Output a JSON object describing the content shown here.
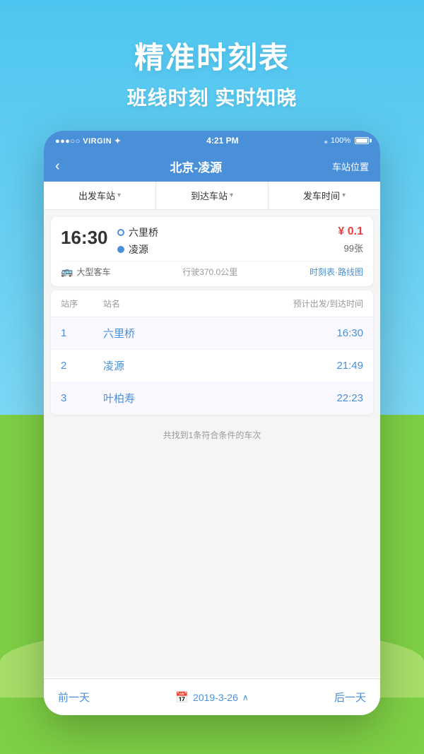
{
  "hero": {
    "title": "精准时刻表",
    "subtitle": "班线时刻 实时知晓"
  },
  "status_bar": {
    "left": "●●●○○ VIRGIN ✦",
    "center": "4:21 PM",
    "right": "100%"
  },
  "nav": {
    "back": "‹",
    "title": "北京-凌源",
    "action": "车站位置"
  },
  "filters": [
    {
      "label": "出发车站",
      "id": "departure"
    },
    {
      "label": "到达车站",
      "id": "arrival"
    },
    {
      "label": "发车时间",
      "id": "time"
    }
  ],
  "bus_card": {
    "time": "16:30",
    "from_stop": "六里桥",
    "to_stop": "凌源",
    "price": "¥ 0.1",
    "tickets": "99张",
    "bus_type": "大型客车",
    "distance": "行驶370.0公里",
    "schedule_link": "时刻表·路线图"
  },
  "schedule": {
    "headers": {
      "seq": "站序",
      "name": "站名",
      "time": "预计出发/到达时间"
    },
    "rows": [
      {
        "seq": "1",
        "name": "六里桥",
        "time": "16:30"
      },
      {
        "seq": "2",
        "name": "凌源",
        "time": "21:49"
      },
      {
        "seq": "3",
        "name": "叶柏寿",
        "time": "22:23"
      }
    ]
  },
  "result_count": "共找到1条符合条件的车次",
  "bottom_bar": {
    "prev": "前一天",
    "date": "2019-3-26",
    "next": "后一天"
  },
  "colors": {
    "accent": "#4a90d9",
    "price": "#e84040",
    "sky": "#5bc8f0",
    "grass": "#7ecf45"
  }
}
